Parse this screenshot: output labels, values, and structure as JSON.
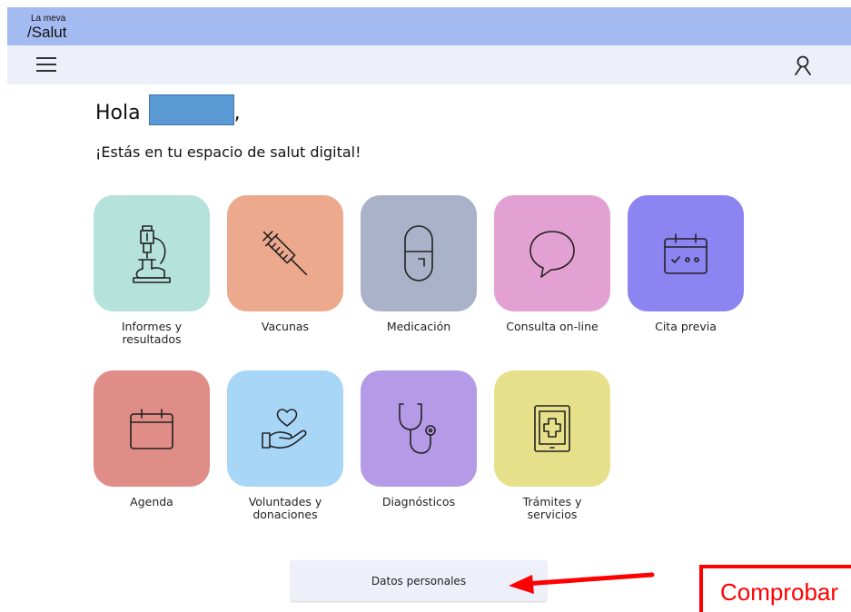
{
  "header": {
    "logo_line1": "La meva",
    "logo_line2": "/Salut",
    "background": "#a4bbf2"
  },
  "nav": {
    "menu_icon": "hamburger-icon",
    "user_icon": "user-icon",
    "background": "#edf0f8"
  },
  "greeting": {
    "hello": "Hola",
    "comma": ",",
    "subtitle": "¡Estás en tu espacio de salut digital!"
  },
  "tiles": [
    {
      "label_1": "Informes y",
      "label_2": "resultados",
      "icon": "microscope-icon",
      "color": "#b5e2da"
    },
    {
      "label_1": "Vacunas",
      "label_2": "",
      "icon": "syringe-icon",
      "color": "#eca98d"
    },
    {
      "label_1": "Medicación",
      "label_2": "",
      "icon": "pill-icon",
      "color": "#aab2ca"
    },
    {
      "label_1": "Consulta on-line",
      "label_2": "",
      "icon": "chat-bubble-icon",
      "color": "#e3a1d3"
    },
    {
      "label_1": "Cita previa",
      "label_2": "",
      "icon": "calendar-appointment-icon",
      "color": "#8c84f1"
    },
    {
      "label_1": "Agenda",
      "label_2": "",
      "icon": "calendar-icon",
      "color": "#e08c87"
    },
    {
      "label_1": "Voluntades y",
      "label_2": "donaciones",
      "icon": "heart-hand-icon",
      "color": "#a8d6f7"
    },
    {
      "label_1": "Diagnósticos",
      "label_2": "",
      "icon": "stethoscope-icon",
      "color": "#b59be7"
    },
    {
      "label_1": "Trámites y",
      "label_2": "servicios",
      "icon": "tablet-medical-icon",
      "color": "#e7e08a"
    }
  ],
  "datos_button": "Datos personales",
  "annotation": {
    "text": "Comprobar",
    "color": "#ff0000"
  }
}
